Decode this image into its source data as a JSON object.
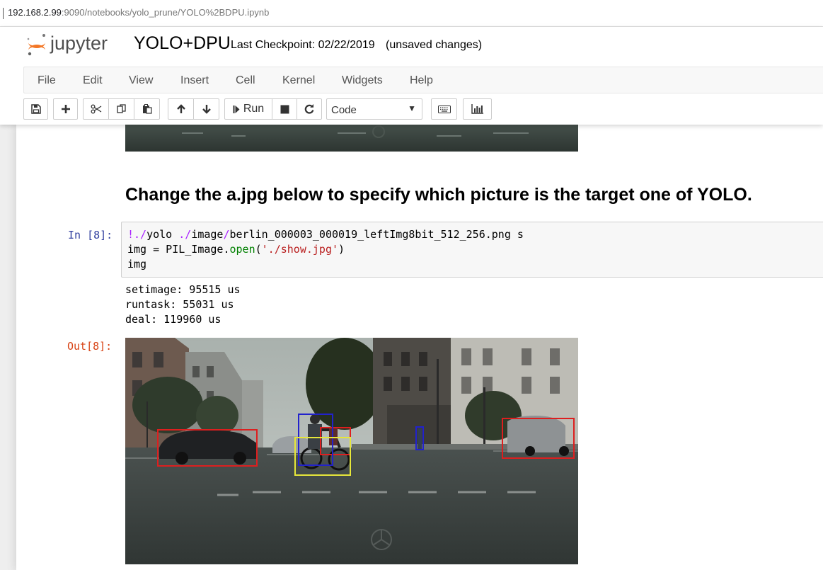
{
  "browser": {
    "url_host": "192.168.2.99",
    "url_rest": ":9090/notebooks/yolo_prune/YOLO%2BDPU.ipynb"
  },
  "header": {
    "logo_text": "jupyter",
    "notebook_title": "YOLO+DPU",
    "checkpoint": "Last Checkpoint: 02/22/2019",
    "unsaved": "(unsaved changes)"
  },
  "menu": [
    "File",
    "Edit",
    "View",
    "Insert",
    "Cell",
    "Kernel",
    "Widgets",
    "Help"
  ],
  "toolbar": {
    "run_label": "Run",
    "cell_type": "Code",
    "icons": [
      "save-icon",
      "plus-icon",
      "scissors-icon",
      "copy-icon",
      "paste-icon",
      "arrow-up-icon",
      "arrow-down-icon",
      "step-forward-icon",
      "stop-icon",
      "restart-icon",
      "keyboard-icon",
      "bar-chart-icon"
    ]
  },
  "notebook": {
    "markdown_heading": "Change the a.jpg below to specify which picture is the target one of YOLO.",
    "input_prompt": "In [8]:",
    "output_prompt": "Out[8]:",
    "code": {
      "l1_bang": "!",
      "l1_a": "./",
      "l1_b": "yolo ",
      "l1_c": "./",
      "l1_d": "image",
      "l1_e": "/",
      "l1_f": "berlin_000003_000019_leftImg8bit_512_256.png s",
      "l2_a": "img = PIL_Image.",
      "l2_open": "open",
      "l2_paren1": "(",
      "l2_str": "'./show.jpg'",
      "l2_paren2": ")",
      "l3": "img"
    },
    "stdout": [
      "setimage: 95515 us",
      "runtask: 55031 us",
      "deal: 119960 us"
    ],
    "detection_colors": {
      "car": "#dd1f1f",
      "person": "#2222cc",
      "bicycle": "#e6e63a"
    }
  }
}
